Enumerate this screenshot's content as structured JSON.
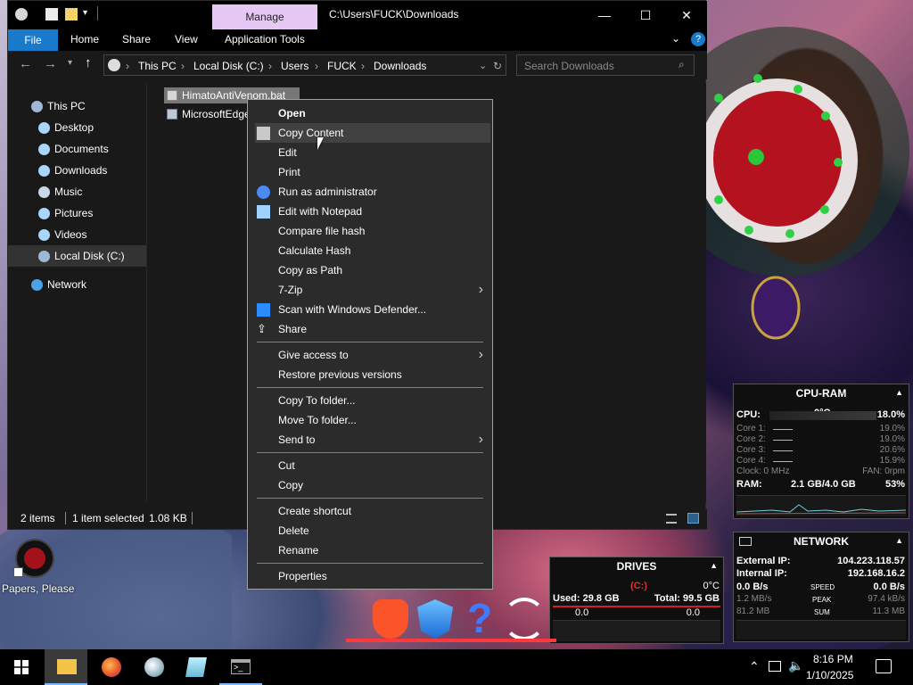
{
  "window": {
    "path_title": "C:\\Users\\FUCK\\Downloads",
    "manage_tab": "Manage",
    "minimize": "—",
    "maximize": "☐",
    "close": "✕"
  },
  "ribbon": {
    "tabs": [
      "File",
      "Home",
      "Share",
      "View",
      "Application Tools"
    ]
  },
  "address": {
    "crumbs": [
      "This PC",
      "Local Disk (C:)",
      "Users",
      "FUCK",
      "Downloads"
    ],
    "search_placeholder": "Search Downloads"
  },
  "navpane": {
    "items": [
      "This PC",
      "Desktop",
      "Documents",
      "Downloads",
      "Music",
      "Pictures",
      "Videos",
      "Local Disk (C:)",
      "Network"
    ],
    "selected": "Local Disk (C:)"
  },
  "files": [
    {
      "name": "HimatoAntiVenom.bat"
    },
    {
      "name": "MicrosoftEdge"
    }
  ],
  "status": {
    "count": "2 items",
    "selection": "1 item selected",
    "size": "1.08 KB"
  },
  "context_menu": {
    "items": [
      {
        "label": "Open",
        "bold": true,
        "icon": ""
      },
      {
        "label": "Copy Content",
        "icon": "clipboard-icon",
        "hover": true
      },
      {
        "label": "Edit",
        "icon": ""
      },
      {
        "label": "Print",
        "icon": ""
      },
      {
        "label": "Run as administrator",
        "icon": "shield-icon"
      },
      {
        "label": "Edit with Notepad",
        "icon": "notepad-icon"
      },
      {
        "label": "Compare file hash",
        "icon": ""
      },
      {
        "label": "Calculate Hash",
        "icon": ""
      },
      {
        "label": "Copy as Path",
        "icon": ""
      },
      {
        "label": "7-Zip",
        "icon": "",
        "submenu": true
      },
      {
        "label": "Scan with Windows Defender...",
        "icon": "defender-icon"
      },
      {
        "label": "Share",
        "icon": "share-icon"
      },
      {
        "separator": true
      },
      {
        "label": "Give access to",
        "icon": "",
        "submenu": true
      },
      {
        "label": "Restore previous versions",
        "icon": ""
      },
      {
        "separator": true
      },
      {
        "label": "Copy To folder...",
        "icon": ""
      },
      {
        "label": "Move To folder...",
        "icon": ""
      },
      {
        "label": "Send to",
        "icon": "",
        "submenu": true
      },
      {
        "separator": true
      },
      {
        "label": "Cut",
        "icon": ""
      },
      {
        "label": "Copy",
        "icon": ""
      },
      {
        "separator": true
      },
      {
        "label": "Create shortcut",
        "icon": ""
      },
      {
        "label": "Delete",
        "icon": ""
      },
      {
        "label": "Rename",
        "icon": ""
      },
      {
        "separator": true
      },
      {
        "label": "Properties",
        "icon": ""
      }
    ]
  },
  "cpu_widget": {
    "title": "CPU-RAM",
    "cpu_label": "CPU:",
    "temp": "0°C",
    "cpu_pct": "18.0%",
    "cores": [
      {
        "label": "Core 1:",
        "value": "19.0%"
      },
      {
        "label": "Core 2:",
        "value": "19.0%"
      },
      {
        "label": "Core 3:",
        "value": "20.6%"
      },
      {
        "label": "Core 4:",
        "value": "15.9%"
      }
    ],
    "clock": "Clock: 0 MHz",
    "fan": "FAN: 0rpm",
    "ram_label": "RAM:",
    "ram_value": "2.1 GB/4.0 GB",
    "ram_pct": "53%"
  },
  "network_widget": {
    "title": "NETWORK",
    "ext_label": "External IP:",
    "ext_value": "104.223.118.57",
    "int_label": "Internal IP:",
    "int_value": "192.168.16.2",
    "speed_down": "0.0 B/s",
    "speed_label": "SPEED",
    "speed_up": "0.0 B/s",
    "peak_down": "1.2 MB/s",
    "peak_label": "PEAK",
    "peak_up": "97.4 kB/s",
    "sum_down": "81.2 MB",
    "sum_label": "SUM",
    "sum_up": "11.3 MB"
  },
  "drives_widget": {
    "title": "DRIVES",
    "drive": "(C:)",
    "temp": "0°C",
    "used": "Used: 29.8 GB",
    "total": "Total: 99.5 GB",
    "read": "0.0",
    "write": "0.0"
  },
  "desktop": {
    "icon_label": "Papers, Please"
  },
  "taskbar": {
    "time": "8:16 PM",
    "date": "1/10/2025"
  },
  "colors": {
    "accent": "#1979ca",
    "manage_tab": "#e7c8f5",
    "menu_bg": "#2b2b2b"
  }
}
